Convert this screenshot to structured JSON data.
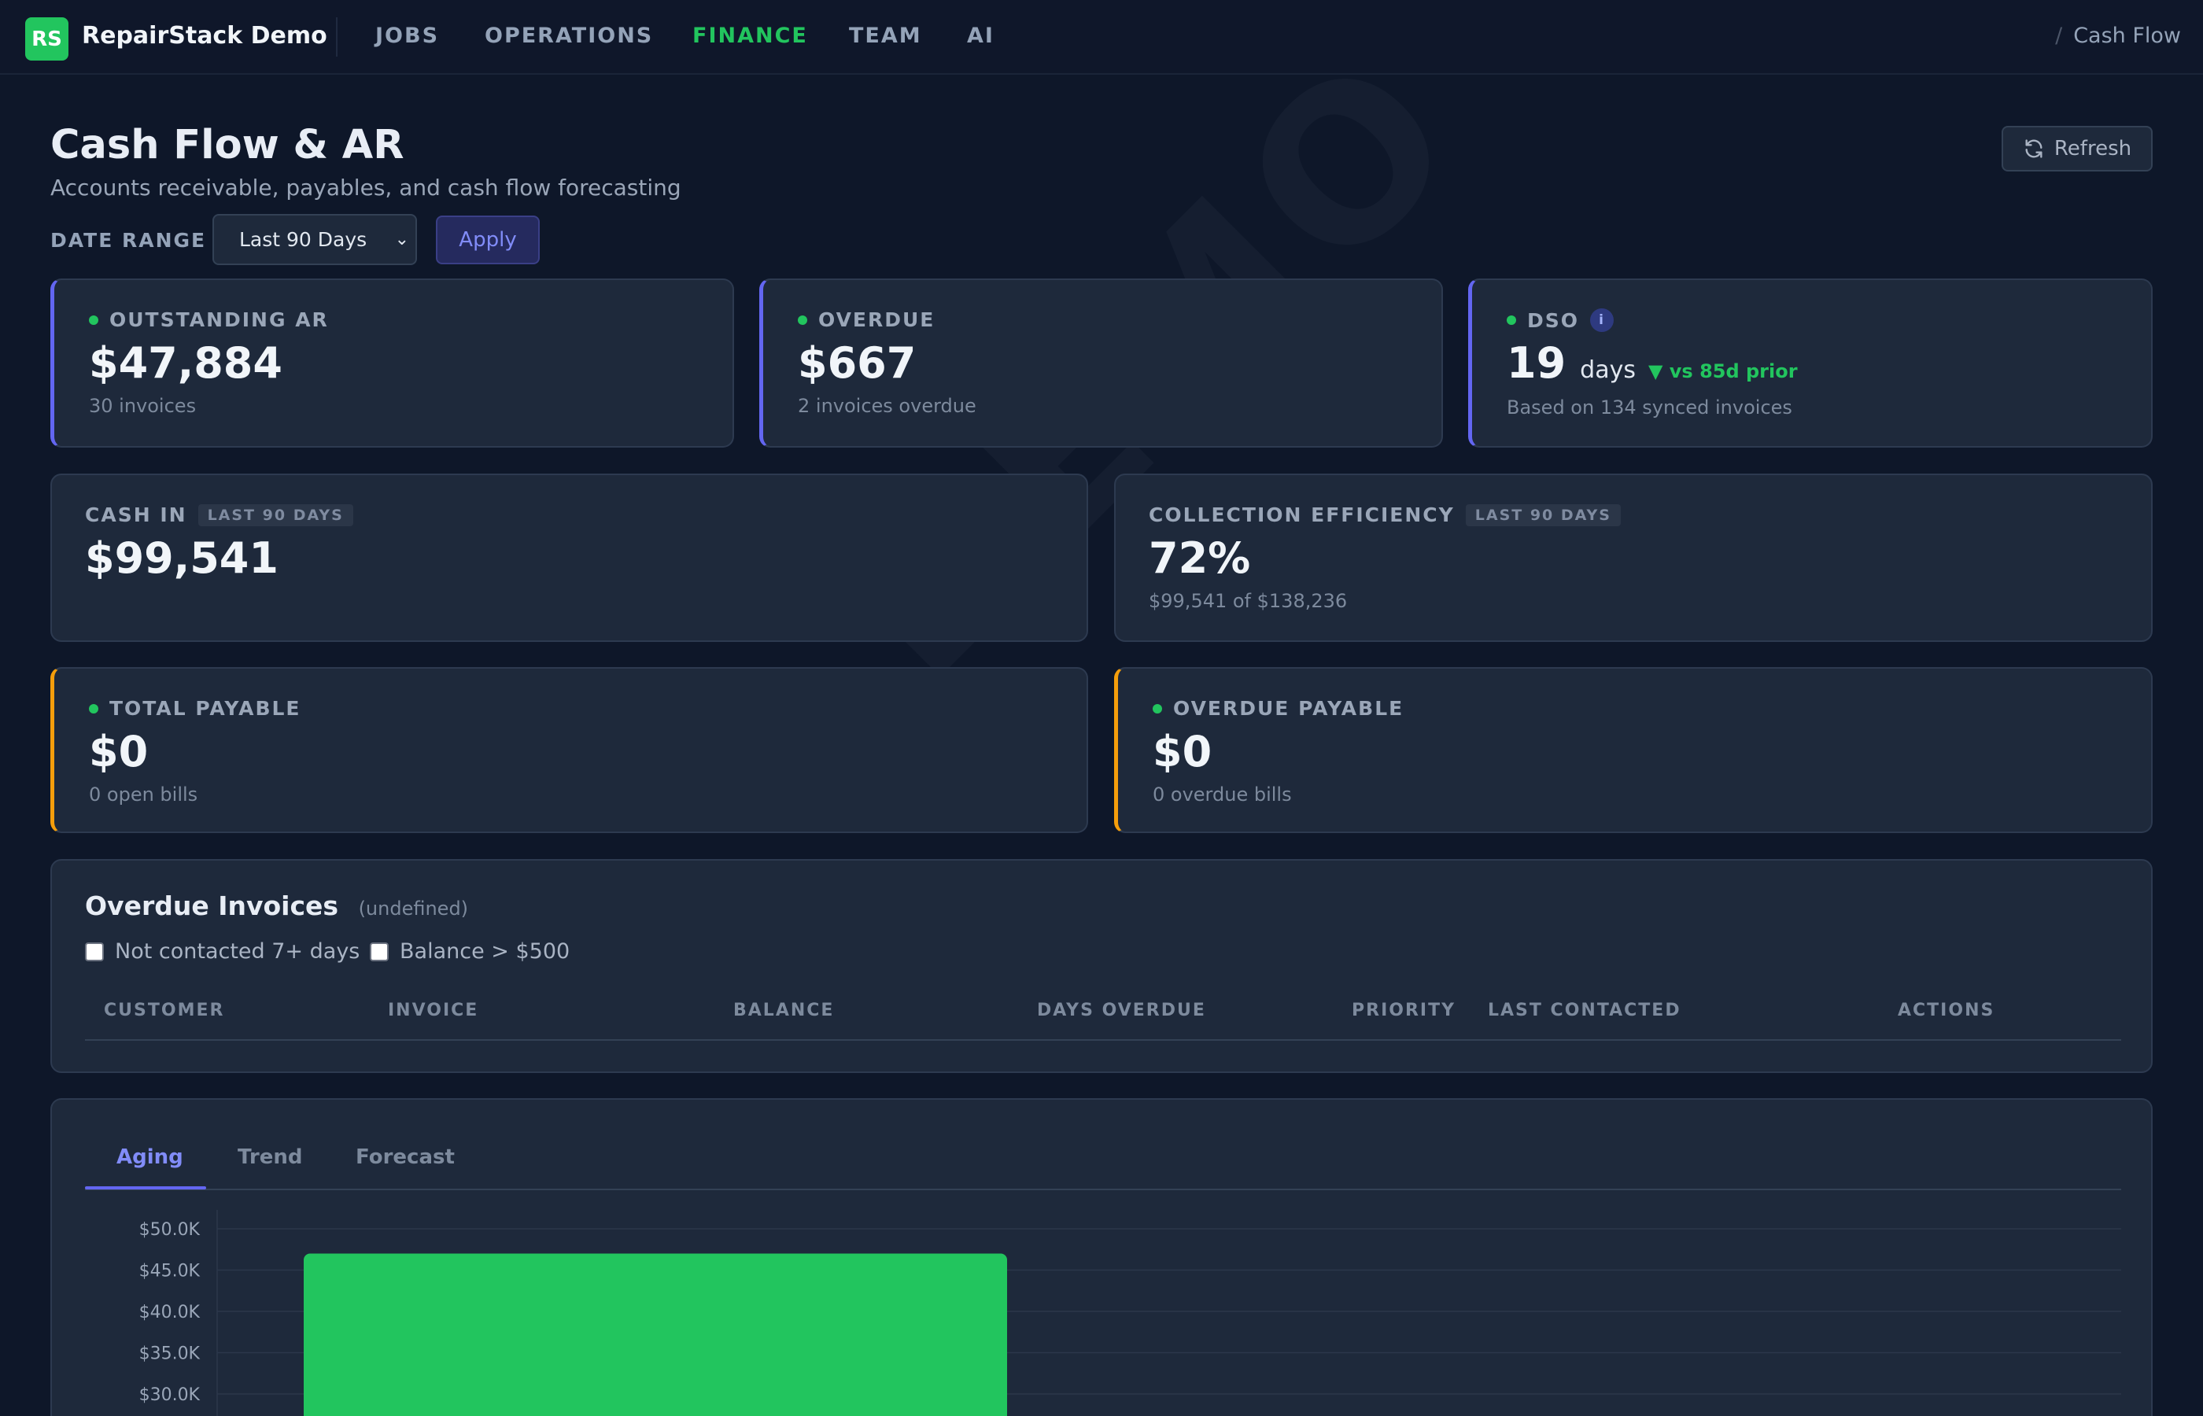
{
  "app": {
    "logo_text": "RS",
    "brand": "RepairStack Demo"
  },
  "nav": {
    "items": [
      {
        "label": "JOBS"
      },
      {
        "label": "OPERATIONS"
      },
      {
        "label": "FINANCE"
      },
      {
        "label": "TEAM"
      },
      {
        "label": "AI"
      }
    ],
    "active": "FINANCE",
    "breadcrumb_sep": "/",
    "breadcrumb": "Cash Flow"
  },
  "header": {
    "title": "Cash Flow & AR",
    "subtitle": "Accounts receivable, payables, and cash flow forecasting",
    "refresh_label": "Refresh"
  },
  "filters": {
    "date_range_label": "DATE RANGE",
    "date_range_value": "Last 90 Days",
    "apply_label": "Apply"
  },
  "kpis": {
    "outstanding_ar": {
      "label": "OUTSTANDING AR",
      "value": "$47,884",
      "sub": "30 invoices"
    },
    "overdue": {
      "label": "OVERDUE",
      "value": "$667",
      "sub": "2 invoices overdue"
    },
    "dso": {
      "label": "DSO",
      "info": "i",
      "value": "19",
      "unit": "days",
      "delta": "▼ vs 85d prior",
      "sub": "Based on 134 synced invoices"
    },
    "cash_in": {
      "label": "CASH IN",
      "tag": "LAST 90 DAYS",
      "value": "$99,541"
    },
    "collection_efficiency": {
      "label": "COLLECTION EFFICIENCY",
      "tag": "LAST 90 DAYS",
      "value": "72%",
      "sub": "$99,541 of $138,236"
    },
    "total_payable": {
      "label": "TOTAL PAYABLE",
      "value": "$0",
      "sub": "0 open bills"
    },
    "overdue_payable": {
      "label": "OVERDUE PAYABLE",
      "value": "$0",
      "sub": "0 overdue bills"
    }
  },
  "overdue_invoices": {
    "title": "Overdue Invoices",
    "title_sub": "(undefined)",
    "filters": [
      {
        "label": "Not contacted 7+ days",
        "checked": false
      },
      {
        "label": "Balance > $500",
        "checked": false
      }
    ],
    "columns": [
      "CUSTOMER",
      "INVOICE",
      "BALANCE",
      "DAYS OVERDUE",
      "PRIORITY",
      "LAST CONTACTED",
      "ACTIONS"
    ]
  },
  "chart_panel": {
    "tabs": [
      {
        "label": "Aging"
      },
      {
        "label": "Trend"
      },
      {
        "label": "Forecast"
      }
    ],
    "active_tab": "Aging"
  },
  "chart_data": {
    "type": "bar",
    "title": "",
    "xlabel": "",
    "ylabel": "",
    "ylim": [
      0,
      50000
    ],
    "y_ticks": [
      "$50.0K",
      "$45.0K",
      "$40.0K",
      "$35.0K",
      "$30.0K"
    ],
    "categories": [
      ""
    ],
    "values": [
      47000
    ],
    "bar_color": "#22c55e",
    "grid": true
  },
  "watermark": "DEMO",
  "colors": {
    "accent": "#6366f1",
    "success": "#22c55e",
    "warning": "#f59e0b",
    "background": "#0e1729",
    "card": "#1e293b"
  }
}
